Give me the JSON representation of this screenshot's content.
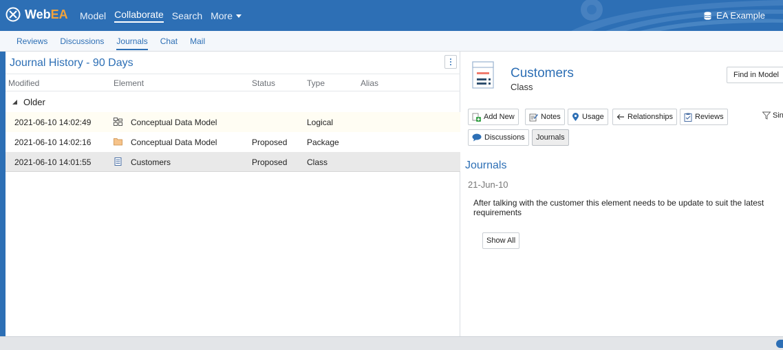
{
  "app": {
    "brand_web": "Web",
    "brand_ea": "EA",
    "nav": [
      {
        "label": "Model"
      },
      {
        "label": "Collaborate"
      },
      {
        "label": "Search"
      },
      {
        "label": "More"
      }
    ],
    "active_nav": "Collaborate",
    "model_name": "EA Example"
  },
  "subtabs": [
    {
      "label": "Reviews"
    },
    {
      "label": "Discussions"
    },
    {
      "label": "Journals"
    },
    {
      "label": "Chat"
    },
    {
      "label": "Mail"
    }
  ],
  "active_subtab": "Journals",
  "journal_list": {
    "title": "Journal History - 90 Days",
    "columns": [
      "Modified",
      "Element",
      "Status",
      "Type",
      "Alias"
    ],
    "group": "Older",
    "rows": [
      {
        "modified": "2021-06-10 14:02:49",
        "element": "Conceptual Data Model",
        "status": "",
        "type": "Logical",
        "alias": "",
        "icon": "logical-diagram-icon"
      },
      {
        "modified": "2021-06-10 14:02:16",
        "element": "Conceptual Data Model",
        "status": "Proposed",
        "type": "Package",
        "alias": "",
        "icon": "package-folder-icon"
      },
      {
        "modified": "2021-06-10 14:01:55",
        "element": "Customers",
        "status": "Proposed",
        "type": "Class",
        "alias": "",
        "icon": "class-icon"
      }
    ]
  },
  "details": {
    "element_name": "Customers",
    "element_type": "Class",
    "find_in_model": "Find in Model",
    "actions": {
      "add_new": "Add New",
      "notes": "Notes",
      "usage": "Usage",
      "relationships": "Relationships",
      "reviews": "Reviews",
      "single": "Single",
      "discussions": "Discussions",
      "journals": "Journals"
    },
    "section_title": "Journals",
    "journal_date": "21-Jun-10",
    "journal_text": "After talking with the customer this element needs to be update to suit the latest requirements",
    "show_all": "Show All"
  },
  "colors": {
    "primary": "#2d6fb5",
    "accent": "#f3a33b",
    "selected_row": "#e9e9e9"
  }
}
